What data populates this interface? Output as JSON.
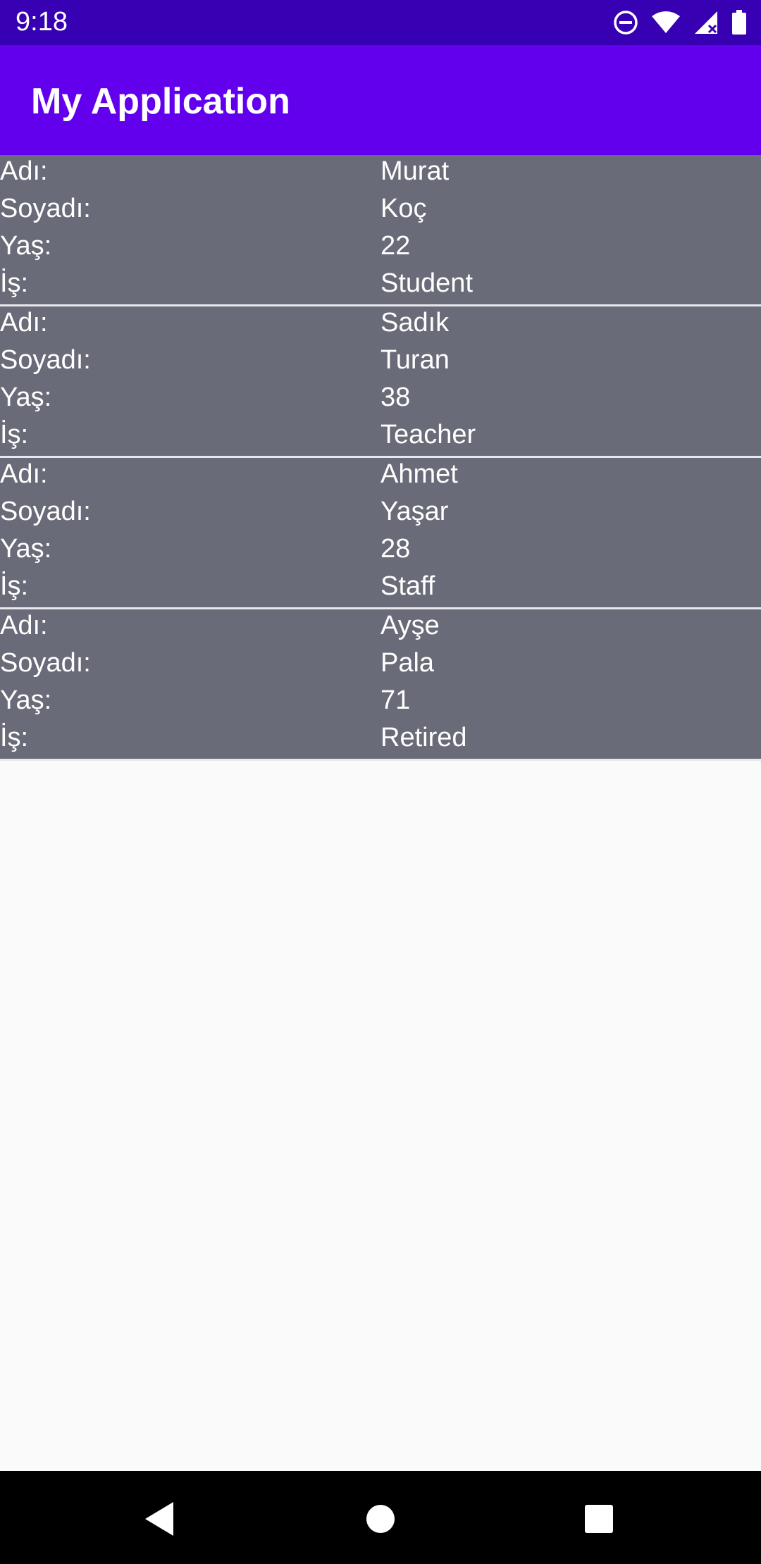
{
  "status_bar": {
    "time": "9:18"
  },
  "app_bar": {
    "title": "My Application"
  },
  "labels": {
    "name": "Adı:",
    "surname": "Soyadı:",
    "age": "Yaş:",
    "job": "İş:"
  },
  "people": [
    {
      "name": "Murat",
      "surname": "Koç",
      "age": "22",
      "job": "Student"
    },
    {
      "name": "Sadık",
      "surname": "Turan",
      "age": "38",
      "job": "Teacher"
    },
    {
      "name": "Ahmet",
      "surname": "Yaşar",
      "age": "28",
      "job": "Staff"
    },
    {
      "name": "Ayşe",
      "surname": "Pala",
      "age": "71",
      "job": "Retired"
    }
  ],
  "colors": {
    "status_bar": "#3700b3",
    "app_bar": "#6200ee",
    "list_item": "#6a6b78",
    "background": "#fafafa"
  },
  "icons": [
    "dnd-icon",
    "wifi-icon",
    "signal-icon",
    "battery-icon",
    "back-icon",
    "home-icon",
    "recents-icon"
  ]
}
